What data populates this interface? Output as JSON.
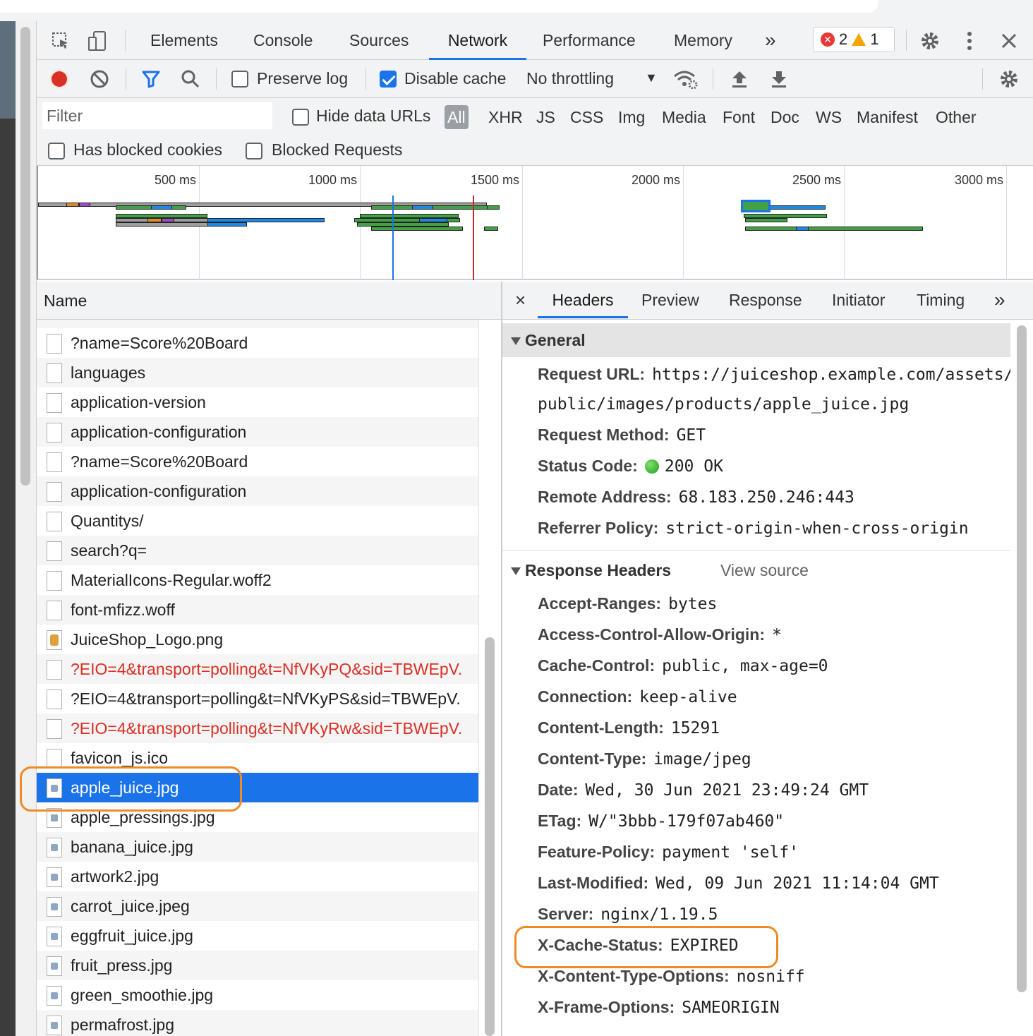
{
  "devtools": {
    "tabs": [
      "Elements",
      "Console",
      "Sources",
      "Network",
      "Performance",
      "Memory"
    ],
    "active_tab": "Network",
    "more_tabs": "»",
    "issues": {
      "errors": "2",
      "warnings": "1"
    }
  },
  "toolbar": {
    "preserve_log": {
      "label": "Preserve log",
      "checked": false
    },
    "disable_cache": {
      "label": "Disable cache",
      "checked": true
    },
    "throttling": "No throttling"
  },
  "filter": {
    "placeholder": "Filter",
    "hide_data_urls": "Hide data URLs",
    "types": [
      "All",
      "XHR",
      "JS",
      "CSS",
      "Img",
      "Media",
      "Font",
      "Doc",
      "WS",
      "Manifest",
      "Other"
    ],
    "active_type": "All",
    "has_blocked_cookies": "Has blocked cookies",
    "blocked_requests": "Blocked Requests"
  },
  "overview": {
    "ticks": [
      "500 ms",
      "1000 ms",
      "1500 ms",
      "2000 ms",
      "2500 ms",
      "3000 ms"
    ]
  },
  "requests": {
    "column": "Name",
    "rows": [
      {
        "name": "?name=Score%20Board",
        "icon": "doc",
        "error": false
      },
      {
        "name": "languages",
        "icon": "doc",
        "error": false
      },
      {
        "name": "application-version",
        "icon": "doc",
        "error": false
      },
      {
        "name": "application-configuration",
        "icon": "doc",
        "error": false
      },
      {
        "name": "?name=Score%20Board",
        "icon": "doc",
        "error": false
      },
      {
        "name": "application-configuration",
        "icon": "doc",
        "error": false
      },
      {
        "name": "Quantitys/",
        "icon": "doc",
        "error": false
      },
      {
        "name": "search?q=",
        "icon": "doc",
        "error": false
      },
      {
        "name": "MaterialIcons-Regular.woff2",
        "icon": "doc",
        "error": false
      },
      {
        "name": "font-mfizz.woff",
        "icon": "doc",
        "error": false
      },
      {
        "name": "JuiceShop_Logo.png",
        "icon": "logo",
        "error": false
      },
      {
        "name": "?EIO=4&transport=polling&t=NfVKyPQ&sid=TBWEpV.",
        "icon": "doc",
        "error": true
      },
      {
        "name": "?EIO=4&transport=polling&t=NfVKyPS&sid=TBWEpV.",
        "icon": "doc",
        "error": false
      },
      {
        "name": "?EIO=4&transport=polling&t=NfVKyRw&sid=TBWEpV.",
        "icon": "doc",
        "error": true
      },
      {
        "name": "favicon_js.ico",
        "icon": "doc",
        "error": false
      },
      {
        "name": "apple_juice.jpg",
        "icon": "img",
        "error": false,
        "selected": true
      },
      {
        "name": "apple_pressings.jpg",
        "icon": "img",
        "error": false
      },
      {
        "name": "banana_juice.jpg",
        "icon": "img",
        "error": false
      },
      {
        "name": "artwork2.jpg",
        "icon": "img",
        "error": false
      },
      {
        "name": "carrot_juice.jpeg",
        "icon": "img",
        "error": false
      },
      {
        "name": "eggfruit_juice.jpg",
        "icon": "img",
        "error": false
      },
      {
        "name": "fruit_press.jpg",
        "icon": "img",
        "error": false
      },
      {
        "name": "green_smoothie.jpg",
        "icon": "img",
        "error": false
      },
      {
        "name": "permafrost.jpg",
        "icon": "img",
        "error": false
      }
    ]
  },
  "details": {
    "tabs": [
      "Headers",
      "Preview",
      "Response",
      "Initiator",
      "Timing"
    ],
    "active_tab": "Headers",
    "more": "»",
    "close": "×",
    "general": {
      "title": "General",
      "request_url_label": "Request URL:",
      "request_url_line1": "https://juiceshop.example.com/assets/",
      "request_url_line2": "public/images/products/apple_juice.jpg",
      "method_label": "Request Method:",
      "method": "GET",
      "status_label": "Status Code:",
      "status": "200 OK",
      "remote_label": "Remote Address:",
      "remote": "68.183.250.246:443",
      "referrer_label": "Referrer Policy:",
      "referrer": "strict-origin-when-cross-origin"
    },
    "response_headers": {
      "title": "Response Headers",
      "view_source": "View source",
      "items": [
        {
          "k": "Accept-Ranges:",
          "v": "bytes"
        },
        {
          "k": "Access-Control-Allow-Origin:",
          "v": "*"
        },
        {
          "k": "Cache-Control:",
          "v": "public, max-age=0"
        },
        {
          "k": "Connection:",
          "v": "keep-alive"
        },
        {
          "k": "Content-Length:",
          "v": "15291"
        },
        {
          "k": "Content-Type:",
          "v": "image/jpeg"
        },
        {
          "k": "Date:",
          "v": "Wed, 30 Jun 2021 23:49:24 GMT"
        },
        {
          "k": "ETag:",
          "v": "W/\"3bbb-179f07ab460\""
        },
        {
          "k": "Feature-Policy:",
          "v": "payment 'self'"
        },
        {
          "k": "Last-Modified:",
          "v": "Wed, 09 Jun 2021 11:14:04 GMT"
        },
        {
          "k": "Server:",
          "v": "nginx/1.19.5"
        },
        {
          "k": "X-Cache-Status:",
          "v": "EXPIRED"
        },
        {
          "k": "X-Content-Type-Options:",
          "v": "nosniff"
        },
        {
          "k": "X-Frame-Options:",
          "v": "SAMEORIGIN"
        }
      ]
    }
  },
  "colors": {
    "accent": "#1a73e8",
    "highlight": "#ef8a26",
    "error_text": "#d93025"
  }
}
